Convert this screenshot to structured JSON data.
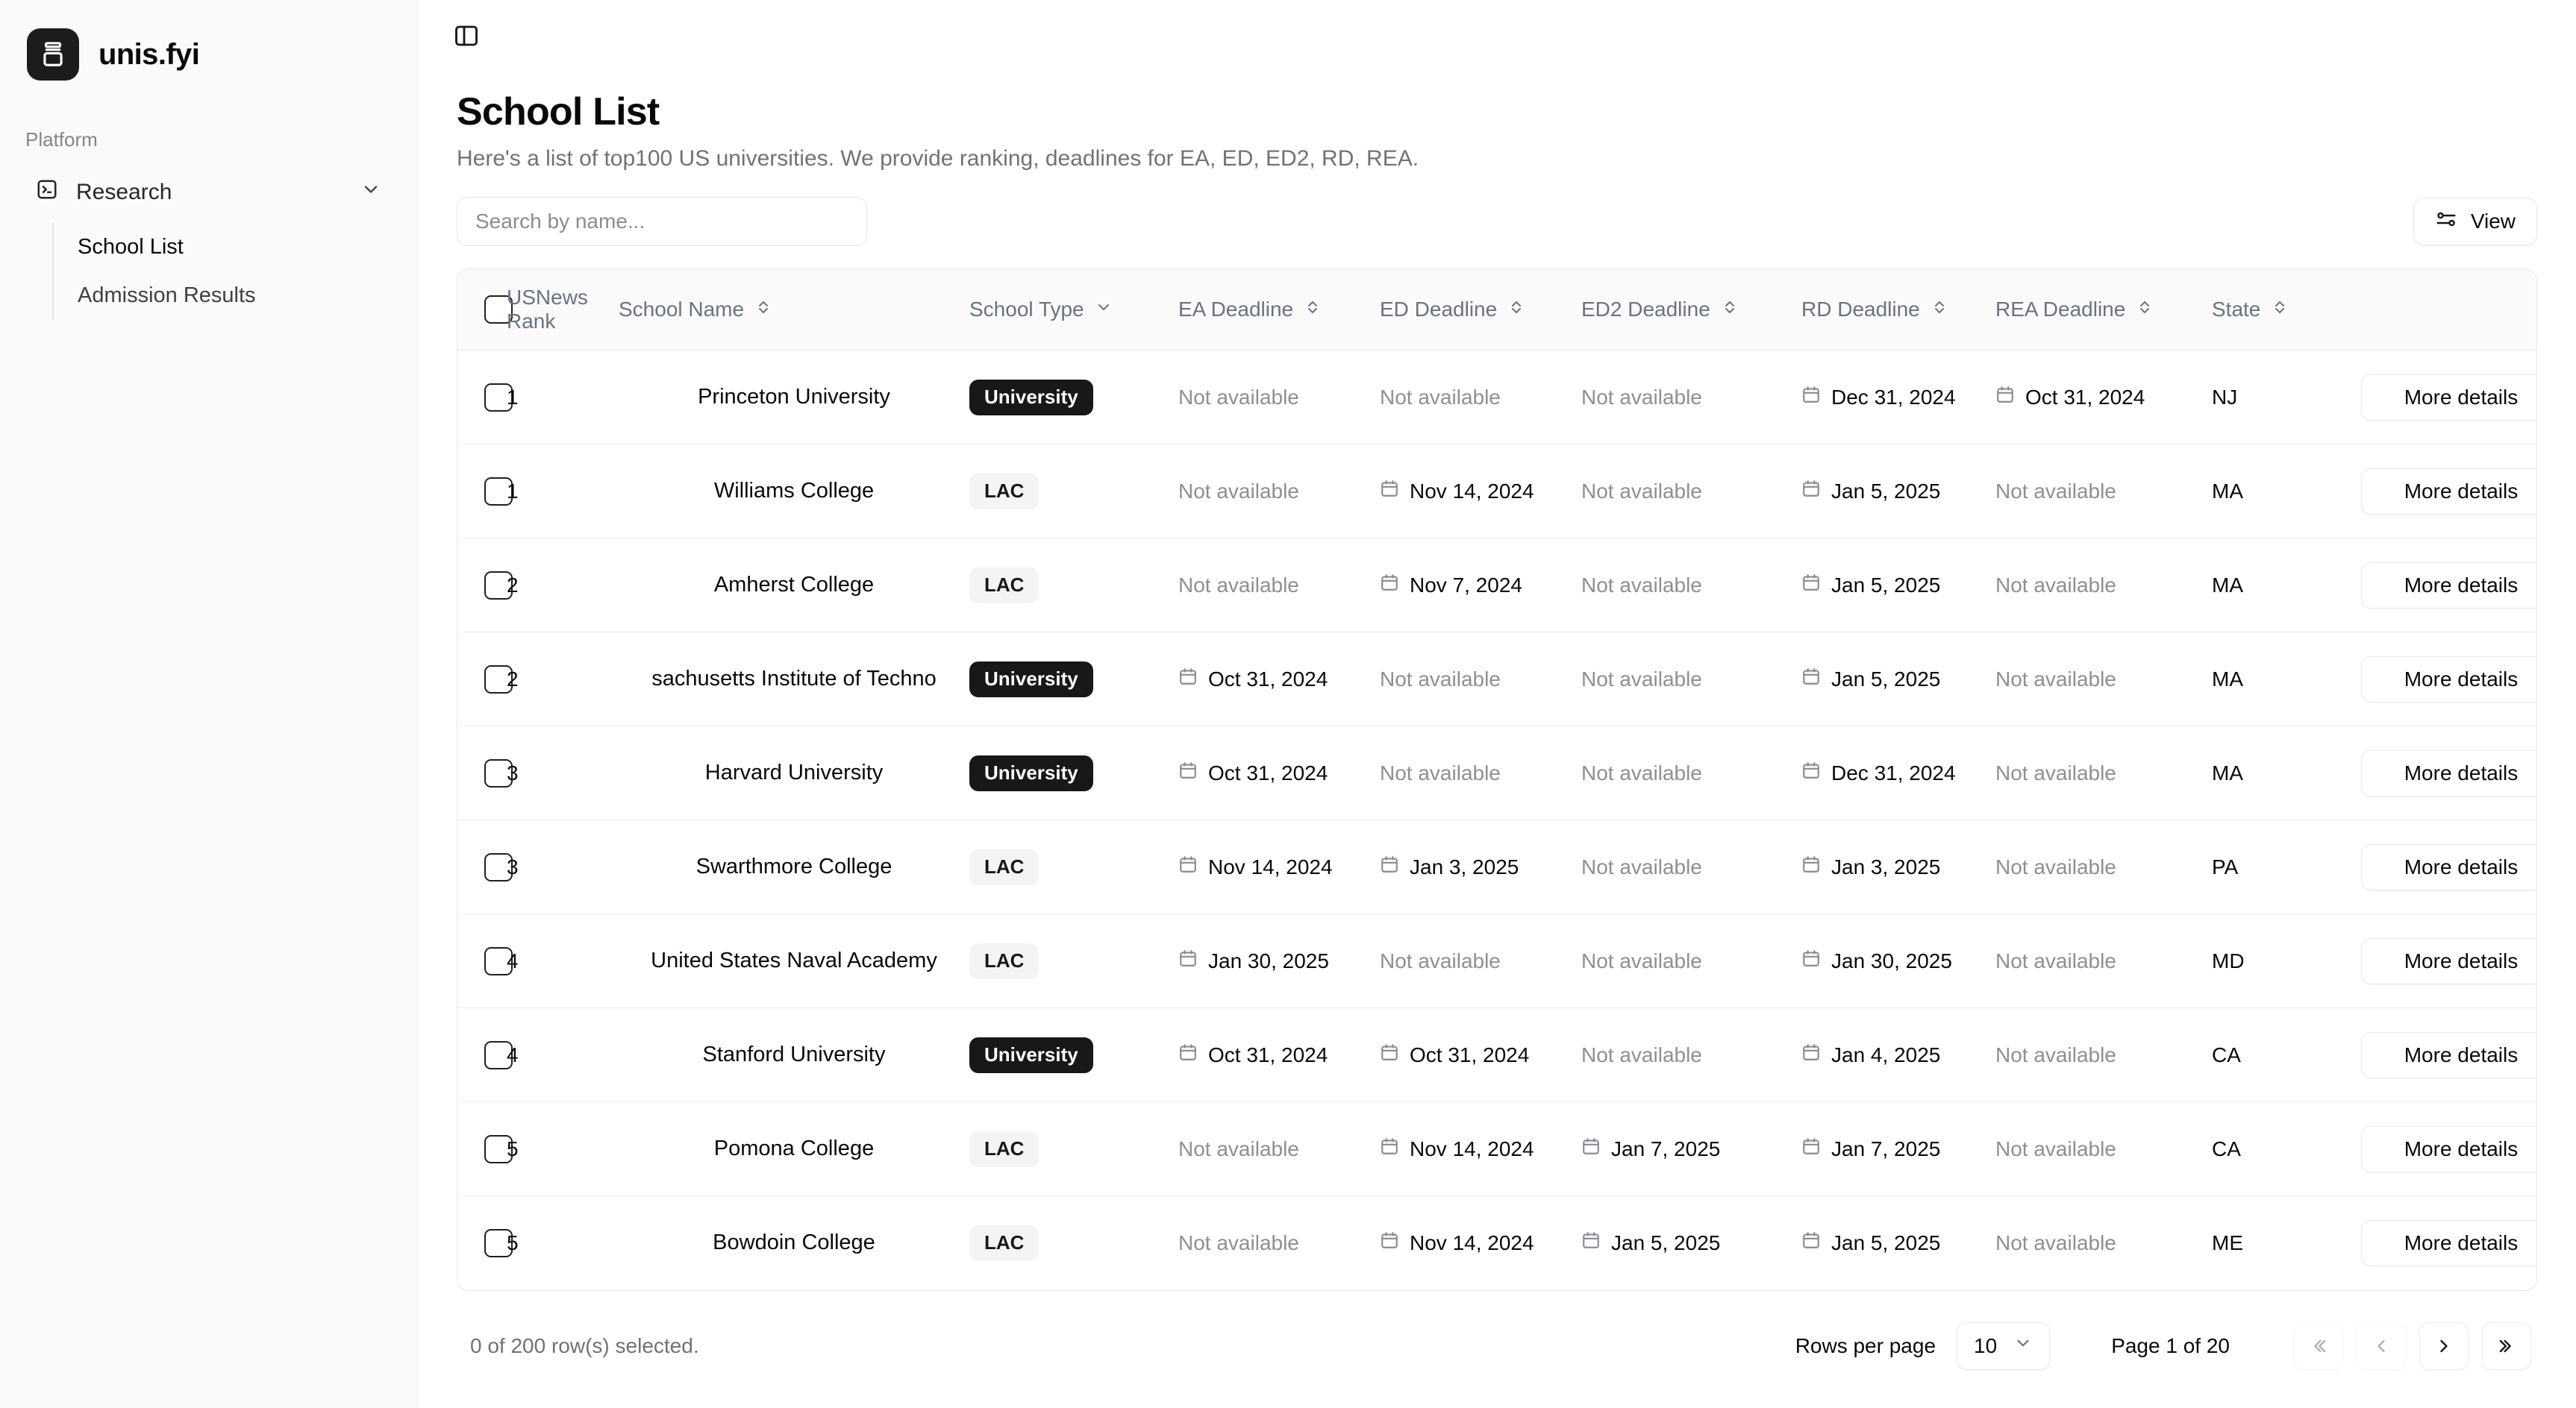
{
  "brand": {
    "name": "unis.fyi",
    "logo_icon": "archive-box-icon"
  },
  "sidebar": {
    "section_label": "Platform",
    "nav": {
      "research": {
        "label": "Research",
        "icon": "terminal-square-icon",
        "chevron": "chevron-down-icon"
      },
      "items": [
        {
          "label": "School List",
          "active": true
        },
        {
          "label": "Admission Results",
          "active": false
        }
      ]
    }
  },
  "topbar": {
    "toggle_icon": "panel-left-icon"
  },
  "page": {
    "title": "School List",
    "subtitle": "Here's a list of top100 US universities. We provide ranking, deadlines for EA, ED, ED2, RD, REA."
  },
  "search": {
    "value": "",
    "placeholder": "Search by name..."
  },
  "view_button": {
    "label": "View",
    "icon": "sliders-icon"
  },
  "table": {
    "columns": [
      {
        "key": "check",
        "label": "",
        "sort": "none"
      },
      {
        "key": "rank",
        "label": "USNews Rank",
        "sort": "none"
      },
      {
        "key": "name",
        "label": "School Name",
        "sort": "chevrons-up-down-icon"
      },
      {
        "key": "type",
        "label": "School Type",
        "sort": "chevron-down-icon"
      },
      {
        "key": "ea",
        "label": "EA Deadline",
        "sort": "chevrons-up-down-icon"
      },
      {
        "key": "ed",
        "label": "ED Deadline",
        "sort": "chevrons-up-down-icon"
      },
      {
        "key": "ed2",
        "label": "ED2 Deadline",
        "sort": "chevrons-up-down-icon"
      },
      {
        "key": "rd",
        "label": "RD Deadline",
        "sort": "chevrons-up-down-icon"
      },
      {
        "key": "rea",
        "label": "REA Deadline",
        "sort": "chevrons-up-down-icon"
      },
      {
        "key": "state",
        "label": "State",
        "sort": "chevrons-up-down-icon"
      },
      {
        "key": "action",
        "label": "",
        "sort": "none"
      }
    ],
    "not_available_text": "Not available",
    "details_label": "More details",
    "rows": [
      {
        "rank": "1",
        "name": "Princeton University",
        "type": "University",
        "ea": "Not available",
        "ed": "Not available",
        "ed2": "Not available",
        "rd": "Dec 31, 2024",
        "rea": "Oct 31, 2024",
        "state": "NJ"
      },
      {
        "rank": "1",
        "name": "Williams College",
        "type": "LAC",
        "ea": "Not available",
        "ed": "Nov 14, 2024",
        "ed2": "Not available",
        "rd": "Jan 5, 2025",
        "rea": "Not available",
        "state": "MA"
      },
      {
        "rank": "2",
        "name": "Amherst College",
        "type": "LAC",
        "ea": "Not available",
        "ed": "Nov 7, 2024",
        "ed2": "Not available",
        "rd": "Jan 5, 2025",
        "rea": "Not available",
        "state": "MA"
      },
      {
        "rank": "2",
        "name": "sachusetts Institute of Techno",
        "type": "University",
        "ea": "Oct 31, 2024",
        "ed": "Not available",
        "ed2": "Not available",
        "rd": "Jan 5, 2025",
        "rea": "Not available",
        "state": "MA"
      },
      {
        "rank": "3",
        "name": "Harvard University",
        "type": "University",
        "ea": "Oct 31, 2024",
        "ed": "Not available",
        "ed2": "Not available",
        "rd": "Dec 31, 2024",
        "rea": "Not available",
        "state": "MA"
      },
      {
        "rank": "3",
        "name": "Swarthmore College",
        "type": "LAC",
        "ea": "Nov 14, 2024",
        "ed": "Jan 3, 2025",
        "ed2": "Not available",
        "rd": "Jan 3, 2025",
        "rea": "Not available",
        "state": "PA"
      },
      {
        "rank": "4",
        "name": "United States Naval Academy",
        "type": "LAC",
        "ea": "Jan 30, 2025",
        "ed": "Not available",
        "ed2": "Not available",
        "rd": "Jan 30, 2025",
        "rea": "Not available",
        "state": "MD"
      },
      {
        "rank": "4",
        "name": "Stanford University",
        "type": "University",
        "ea": "Oct 31, 2024",
        "ed": "Oct 31, 2024",
        "ed2": "Not available",
        "rd": "Jan 4, 2025",
        "rea": "Not available",
        "state": "CA"
      },
      {
        "rank": "5",
        "name": "Pomona College",
        "type": "LAC",
        "ea": "Not available",
        "ed": "Nov 14, 2024",
        "ed2": "Jan 7, 2025",
        "rd": "Jan 7, 2025",
        "rea": "Not available",
        "state": "CA"
      },
      {
        "rank": "5",
        "name": "Bowdoin College",
        "type": "LAC",
        "ea": "Not available",
        "ed": "Nov 14, 2024",
        "ed2": "Jan 5, 2025",
        "rd": "Jan 5, 2025",
        "rea": "Not available",
        "state": "ME"
      }
    ]
  },
  "footer": {
    "rows_selected": "0 of 200 row(s) selected.",
    "rows_per_page_label": "Rows per page",
    "rows_per_page_value": "10",
    "page_indicator": "Page 1 of 20",
    "pager": {
      "first": "«",
      "prev": "‹",
      "next": "›",
      "last": "»"
    }
  },
  "colors": {
    "accent": "#18181b",
    "badge_dark_bg": "#18181b",
    "badge_light_bg": "#f4f4f5",
    "muted_text": "#8e8e96",
    "border": "#e8e8eb",
    "sidebar_bg": "#fafafa"
  }
}
